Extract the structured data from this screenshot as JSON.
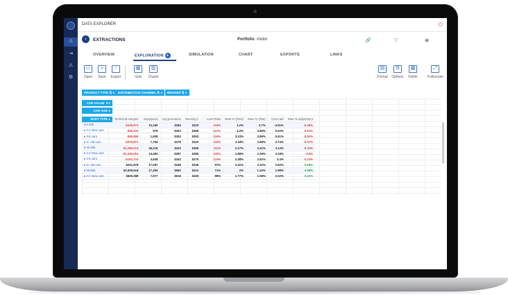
{
  "app": {
    "title": "DATA EXPLORER"
  },
  "header": {
    "back_label": "EXTRACTIONS",
    "portfolio_label": "Portfolio",
    "portfolio_value": ": motor"
  },
  "tabs": [
    {
      "label": "OVERVIEW"
    },
    {
      "label": "EXPLORATION"
    },
    {
      "label": "SIMULATION"
    },
    {
      "label": "CHART"
    },
    {
      "label": "EXPORTS"
    },
    {
      "label": "LINKS"
    }
  ],
  "toolbar": {
    "left": [
      {
        "label": "Open",
        "icon": "folder-icon"
      },
      {
        "label": "Save",
        "icon": "save-icon"
      },
      {
        "label": "Export",
        "icon": "export-icon"
      },
      {
        "label": "Grid",
        "icon": "grid-icon"
      },
      {
        "label": "Charts",
        "icon": "chart-icon"
      }
    ],
    "right": [
      {
        "label": "Format",
        "icon": "format-icon"
      },
      {
        "label": "Options",
        "icon": "gear-icon"
      },
      {
        "label": "Fields",
        "icon": "fields-icon"
      },
      {
        "label": "Fullscreen",
        "icon": "fullscreen-icon"
      }
    ]
  },
  "filters": {
    "chips": [
      "PRODUCT TYPE",
      "DISTRIBUTION CHANNEL",
      "BROKER"
    ],
    "rows": [
      "CAR VALUE",
      "CAR AGE",
      "BODY TYPE"
    ]
  },
  "table": {
    "columns": [
      "Technical margins",
      "Exposures",
      "Avg premiums",
      "Running c",
      "Loss Ratio",
      "Rate % (Rsol)",
      "Rate % (Rtol)",
      "Cum rate",
      "Rate % adjustment"
    ],
    "rows": [
      {
        "label": "▾ 0-10k",
        "cells": [
          "-$445,873",
          "10,180",
          "$284",
          "$320",
          "116%",
          "3.2%",
          "3.7%",
          "-4.91%",
          "-6.46%"
        ],
        "group": true
      },
      {
        "label": "▸ 0-2 New cars",
        "cells": [
          "-$56,432",
          "978",
          "$302",
          "$365",
          "121%",
          "3.2%",
          "3.86%",
          "5.02%",
          "-5.61%"
        ],
        "group": false
      },
      {
        "label": "▸ 3-5 cars",
        "cells": [
          "-$69,569",
          "1,608",
          "$304",
          "$353",
          "116%",
          "3.33%",
          "3.86%",
          "5.61%",
          "-5.92%"
        ],
        "group": false
      },
      {
        "label": "▸ 5+ old cars",
        "cells": [
          "-$319,871",
          "7,794",
          "$278",
          "$320",
          "116%",
          "3.18%",
          "3.68%",
          "4.74%",
          "-6.47%"
        ],
        "group": false
      },
      {
        "label": "▾ 10-20k",
        "cells": [
          "-$1,296,913",
          "36,218",
          "$323",
          "$359",
          "111%",
          "2.17%",
          "2.41%",
          "3.13%",
          "-5.34%"
        ],
        "group": true
      },
      {
        "label": "▸ 0-2 New cars",
        "cells": [
          "-$1,349,061",
          "14,483",
          "$287",
          "$380",
          "132%",
          "1.88%",
          "2.49%",
          "3.18%",
          "-0.6%"
        ],
        "group": false
      },
      {
        "label": "▸ 3-5 cars",
        "cells": [
          "-$193,710",
          "4,628",
          "$342",
          "$275",
          "110%",
          "2.38%",
          "2.61%",
          "3.4%",
          "-0.23%"
        ],
        "group": false
      },
      {
        "label": "▸ 5+ old cars",
        "cells": [
          "$251,878",
          "17,097",
          "$348",
          "$336",
          "97%",
          "2.41%",
          "2.32%",
          "2.92%",
          "5.59%"
        ],
        "group": false
      },
      {
        "label": "▾ 20-50k",
        "cells": [
          "$2,939,918",
          "17,494",
          "$583",
          "$414",
          "71%",
          "2%",
          "1.42%",
          "1.98%",
          "5.98%"
        ],
        "group": true
      },
      {
        "label": "▸ 0-2 New cars",
        "cells": [
          "$509,288",
          "7,977",
          "$618",
          "$450",
          "89%",
          "1.77%",
          "1.58%",
          "2.02%",
          "5.22%"
        ],
        "group": false
      }
    ]
  },
  "colors": {
    "sidebar": "#162a55",
    "accent": "#2b62c7",
    "chip": "#1ea7e6",
    "negative": "#e03a3a",
    "positive": "#2aa84a"
  }
}
